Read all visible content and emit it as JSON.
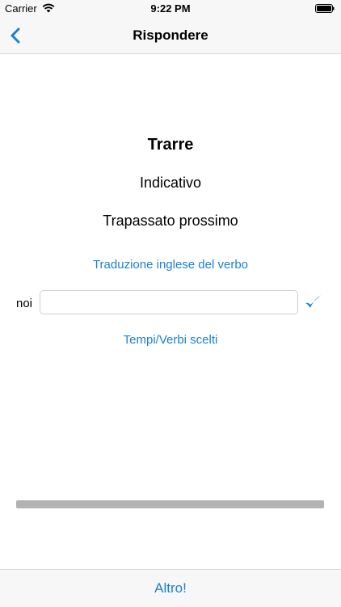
{
  "status_bar": {
    "carrier": "Carrier",
    "time": "9:22 PM"
  },
  "nav": {
    "title": "Rispondere"
  },
  "quiz": {
    "verb": "Trarre",
    "mood": "Indicativo",
    "tense": "Trapassato prossimo",
    "translation_link": "Traduzione inglese del verbo",
    "pronoun": "noi",
    "answer_value": "",
    "answer_placeholder": "",
    "tenses_link": "Tempi/Verbi scelti",
    "progress": 0
  },
  "footer": {
    "more_label": "Altro!"
  },
  "colors": {
    "accent": "#1a7fd6",
    "progress_track": "#b3b3b3"
  },
  "icons": {
    "back": "chevron-left-icon",
    "check": "checkmark-icon",
    "wifi": "wifi-icon",
    "battery": "battery-icon"
  }
}
